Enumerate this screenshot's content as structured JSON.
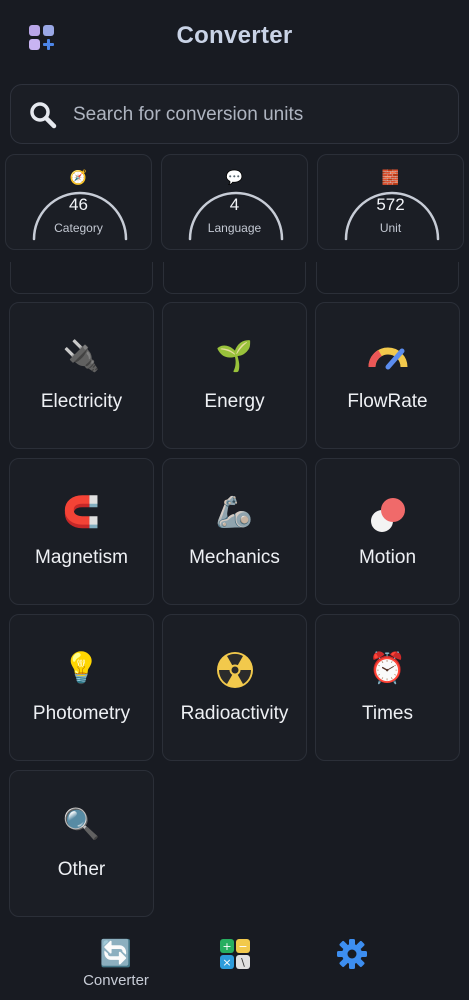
{
  "header": {
    "title": "Converter",
    "menu_icon": "grid-plus-icon"
  },
  "search": {
    "placeholder": "Search for conversion units",
    "icon": "search-icon"
  },
  "stats": [
    {
      "icon": "pie-chart-icon",
      "value": "46",
      "label": "Category"
    },
    {
      "icon": "speech-bubbles-icon",
      "value": "4",
      "label": "Language"
    },
    {
      "icon": "blocks-icon",
      "value": "572",
      "label": "Unit"
    }
  ],
  "categories": [
    {
      "icon": "plug-lightning-icon",
      "label": "Electricity"
    },
    {
      "icon": "leaf-lightning-icon",
      "label": "Energy"
    },
    {
      "icon": "gauge-icon",
      "label": "FlowRate"
    },
    {
      "icon": "magnet-icon",
      "label": "Magnetism"
    },
    {
      "icon": "robot-arm-icon",
      "label": "Mechanics"
    },
    {
      "icon": "motion-balls-icon",
      "label": "Motion"
    },
    {
      "icon": "light-bulb-icon",
      "label": "Photometry"
    },
    {
      "icon": "radioactive-icon",
      "label": "Radioactivity"
    },
    {
      "icon": "stopwatch-icon",
      "label": "Times"
    },
    {
      "icon": "magnifier-eye-icon",
      "label": "Other"
    }
  ],
  "bottom_nav": [
    {
      "icon": "converter-cubes-icon",
      "label": "Converter"
    },
    {
      "icon": "calculator-icon",
      "label": ""
    },
    {
      "icon": "gear-icon",
      "label": ""
    }
  ],
  "colors": {
    "background": "#181b22",
    "card": "#1b1e25",
    "border": "#2b2f38",
    "title": "#c9d3e6"
  }
}
